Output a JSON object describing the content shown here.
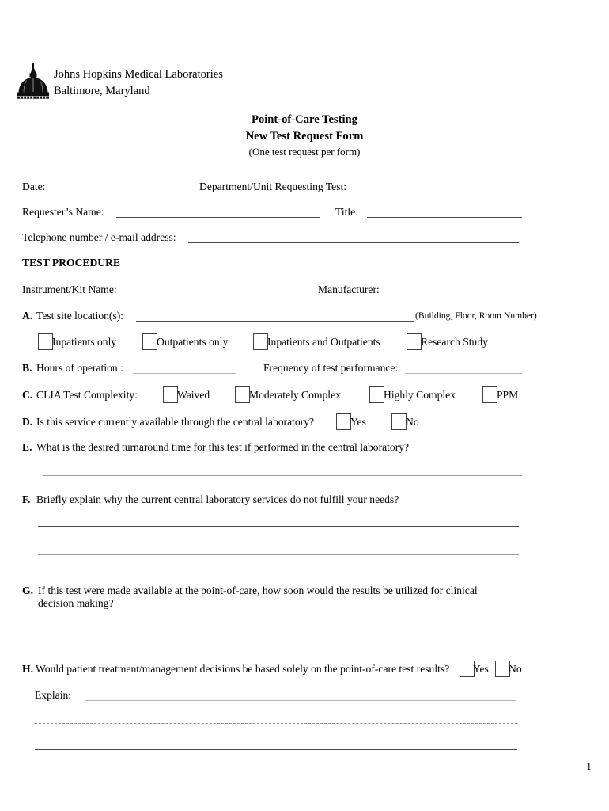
{
  "header": {
    "logo_icon": "johns-hopkins-dome-icon",
    "org_name": "Johns Hopkins Medical Laboratories",
    "org_city": "Baltimore, Maryland"
  },
  "title": {
    "line1": "Point-of-Care Testing",
    "line2": "New Test Request Form",
    "line3": "(One test request per form)"
  },
  "fields": {
    "date_label": "Date:",
    "date_value": "",
    "department_label": "Department/Unit Requesting Test:",
    "department_value": "",
    "requester_label": "Requester’s Name:",
    "requester_value": "",
    "title_label": "Title:",
    "title_value": "",
    "phone_label": "Telephone number / e-mail address:",
    "phone_value": "",
    "test_procedure_label": "TEST PROCEDURE",
    "test_procedure_colon": ":",
    "test_procedure_value": "",
    "instrument_label": "Instrument/Kit Name:",
    "instrument_value": "",
    "manufacturer_label": "Manufacturer:",
    "manufacturer_value": ""
  },
  "sections": {
    "a": {
      "letter": "A.",
      "label": "Test site location(s):",
      "value": "",
      "hint": "(Building, Floor, Room Number)",
      "options": [
        {
          "label": "Inpatients only",
          "checked": false
        },
        {
          "label": "Outpatients only",
          "checked": false
        },
        {
          "label": "Inpatients and Outpatients",
          "checked": false
        },
        {
          "label": "Research Study",
          "checked": false
        }
      ]
    },
    "b": {
      "letter": "B.",
      "label": "Hours of operation :",
      "value": "",
      "label2": "Frequency of test performance:",
      "value2": ""
    },
    "c": {
      "letter": "C.",
      "label": "CLIA Test Complexity:",
      "options": [
        {
          "label": "Waived",
          "checked": false
        },
        {
          "label": "Moderately Complex",
          "checked": false
        },
        {
          "label": "Highly Complex",
          "checked": false
        },
        {
          "label": "PPM",
          "checked": false
        }
      ]
    },
    "d": {
      "letter": "D.",
      "label": "Is this service currently available through the central laboratory?",
      "options": [
        {
          "label": "Yes",
          "checked": false
        },
        {
          "label": "No",
          "checked": false
        }
      ]
    },
    "e": {
      "letter": "E.",
      "label": "What is the desired turnaround time for this test if performed in the central laboratory?",
      "answer_lines": [
        "",
        ""
      ]
    },
    "f": {
      "letter": "F.",
      "label": "Briefly explain why the current central laboratory services do not fulfill your needs?",
      "answer_lines": [
        "",
        ""
      ]
    },
    "g": {
      "letter": "G.",
      "label_line1": "If this test were made available at the point-of-care, how soon would the results be utilized for clinical",
      "label_line2": "decision making?",
      "answer_lines": [
        ""
      ]
    },
    "h": {
      "letter": "H.",
      "label": "Would patient treatment/management decisions be based solely on the point-of-care test results?",
      "options": [
        {
          "label": "Yes",
          "checked": false
        },
        {
          "label": "No",
          "checked": false
        }
      ],
      "explain_label": "Explain:",
      "explain_lines": [
        "",
        "",
        ""
      ]
    }
  },
  "footer": {
    "page_number": "1"
  }
}
